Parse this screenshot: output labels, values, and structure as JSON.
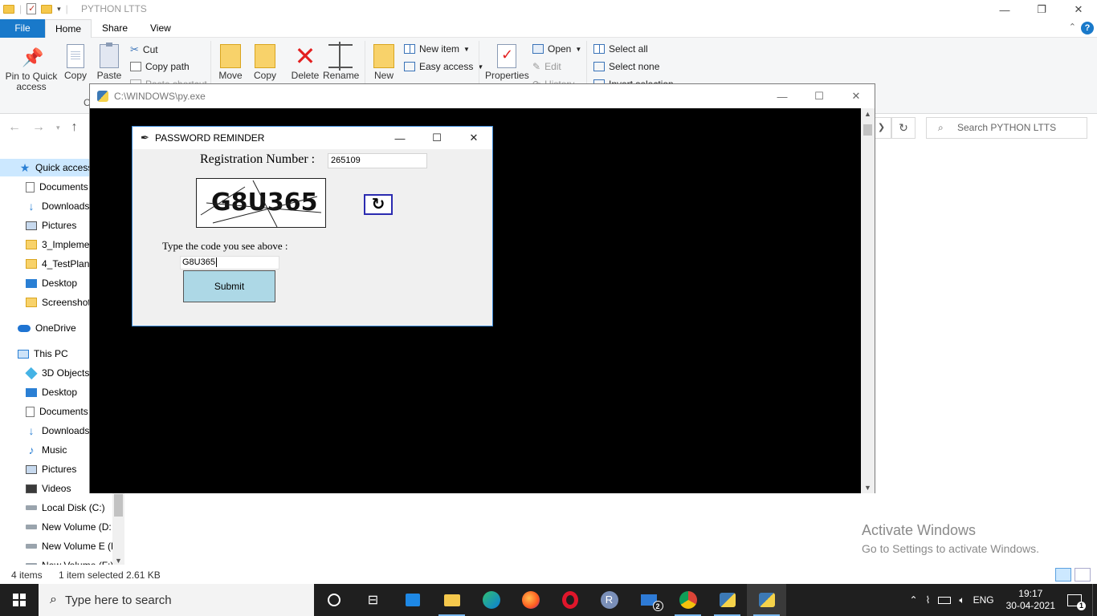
{
  "explorer": {
    "title": "PYTHON LTTS",
    "tabs": [
      "File",
      "Home",
      "Share",
      "View"
    ],
    "ribbon": {
      "pin": "Pin to Quick access",
      "copy": "Copy",
      "paste": "Paste",
      "cut": "Cut",
      "copy_path": "Copy path",
      "paste_shortcut": "Paste shortcut",
      "move": "Move",
      "copy_to": "Copy",
      "delete": "Delete",
      "rename": "Rename",
      "new": "New",
      "new_item": "New item",
      "easy_access": "Easy access",
      "properties": "Properties",
      "open": "Open",
      "edit": "Edit",
      "history": "History",
      "select_all": "Select all",
      "select_none": "Select none",
      "invert_selection": "Invert selection",
      "clipboard_cut_off": "C"
    },
    "search_placeholder": "Search PYTHON LTTS",
    "sidebar": [
      {
        "label": "Quick access",
        "icon": "star-icon",
        "selected": true
      },
      {
        "label": "Documents",
        "icon": "documents-icon"
      },
      {
        "label": "Downloads",
        "icon": "download-icon"
      },
      {
        "label": "Pictures",
        "icon": "pictures-icon"
      },
      {
        "label": "3_Impleme",
        "icon": "folder-icon"
      },
      {
        "label": "4_TestPlan",
        "icon": "folder-icon"
      },
      {
        "label": "Desktop",
        "icon": "desktop-icon"
      },
      {
        "label": "Screenshot",
        "icon": "folder-icon"
      },
      {
        "label": "OneDrive",
        "icon": "onedrive-icon"
      },
      {
        "label": "This PC",
        "icon": "pc-icon"
      },
      {
        "label": "3D Objects",
        "icon": "cube-icon"
      },
      {
        "label": "Desktop",
        "icon": "desktop-icon"
      },
      {
        "label": "Documents",
        "icon": "documents-icon"
      },
      {
        "label": "Downloads",
        "icon": "download-icon"
      },
      {
        "label": "Music",
        "icon": "music-icon"
      },
      {
        "label": "Pictures",
        "icon": "pictures-icon"
      },
      {
        "label": "Videos",
        "icon": "videos-icon"
      },
      {
        "label": "Local Disk (C:)",
        "icon": "drive-icon"
      },
      {
        "label": "New Volume (D:",
        "icon": "drive-icon"
      },
      {
        "label": "New Volume E (E",
        "icon": "drive-icon"
      },
      {
        "label": "New Volume (F:)",
        "icon": "drive-icon"
      }
    ],
    "status": {
      "items": "4 items",
      "selected": "1 item selected  2.61 KB"
    }
  },
  "watermark": {
    "line1": "Activate Windows",
    "line2": "Go to Settings to activate Windows."
  },
  "console": {
    "title": "C:\\WINDOWS\\py.exe"
  },
  "dialog": {
    "title": "PASSWORD REMINDER",
    "reg_label": "Registration Number :",
    "reg_value": "265109",
    "captcha_text": "G8U365",
    "code_label": "Type the code you see above :",
    "code_value": "G8U365",
    "submit": "Submit"
  },
  "taskbar": {
    "search_placeholder": "Type here to search",
    "lang": "ENG",
    "time": "19:17",
    "date": "30-04-2021",
    "mail_badge": "2",
    "r_label": "R",
    "notif_count": "1"
  }
}
